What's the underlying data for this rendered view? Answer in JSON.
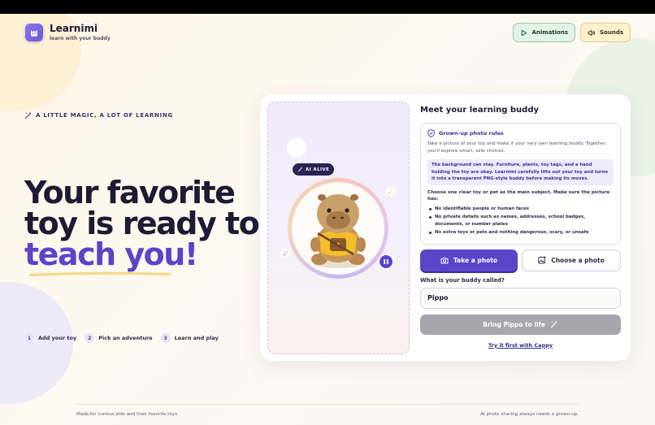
{
  "brand": {
    "name": "Learnimi",
    "tagline": "learn with your buddy"
  },
  "top_actions": {
    "animations_label": "Animations",
    "sounds_label": "Sounds"
  },
  "hero": {
    "eyebrow": "A LITTLE MAGIC, A LOT OF LEARNING",
    "headline_line1": "Your favorite",
    "headline_line2": "toy is ready to",
    "headline_accent": "teach you!"
  },
  "steps": [
    {
      "num": "1",
      "label": "Add your toy"
    },
    {
      "num": "2",
      "label": "Pick an adventure"
    },
    {
      "num": "3",
      "label": "Learn and play"
    }
  ],
  "preview": {
    "badge": "AI ALIVE"
  },
  "panel": {
    "title": "Meet your learning buddy",
    "rules": {
      "heading": "Grown-up photo rules",
      "intro": "Take a picture of your toy and make it your very own learning buddy. Together, you'll explore smart, safe choices.",
      "note": "The background can stay. Furniture, plants, toy tags, and a hand holding the toy are okay. Learnimi carefully lifts out your toy and turns it into a transparent PNG-style buddy before making its moves.",
      "choose": "Choose one clear toy or pet as the main subject. Make sure the picture has:",
      "items": [
        "No identifiable people or human faces",
        "No private details such as names, addresses, school badges, documents, or number plates",
        "No extra toys or pets and nothing dangerous, scary, or unsafe"
      ]
    },
    "take_photo_label": "Take a photo",
    "choose_photo_label": "Choose a photo",
    "name_question": "What is your buddy called?",
    "name_value": "Pippo",
    "bring_button_label": "Bring Pippo to life",
    "try_link_label": "Try it first with Cappy"
  },
  "footer": {
    "left": "Made for curious kids and their favorite toys.",
    "right": "AI photo sharing always needs a grown-up."
  },
  "colors": {
    "accent": "#5a45c8",
    "dark": "#1d1a33",
    "disabled": "#a7a5ae"
  }
}
